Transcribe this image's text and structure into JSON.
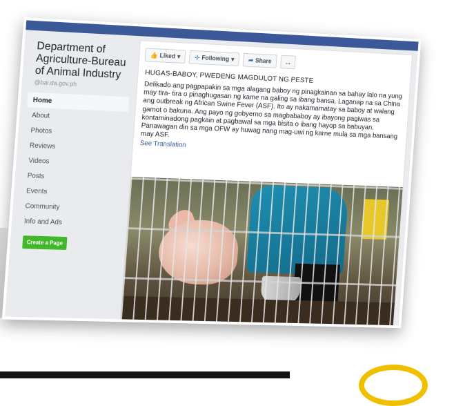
{
  "page": {
    "name_line1": "Department of",
    "name_line2": "Agriculture-Bureau",
    "name_line3": "of Animal Industry",
    "handle": "@bai.da.gov.ph"
  },
  "nav": {
    "items": [
      {
        "label": "Home"
      },
      {
        "label": "About"
      },
      {
        "label": "Photos"
      },
      {
        "label": "Reviews"
      },
      {
        "label": "Videos"
      },
      {
        "label": "Posts"
      },
      {
        "label": "Events"
      },
      {
        "label": "Community"
      },
      {
        "label": "Info and Ads"
      }
    ],
    "create_page_label": "Create a Page"
  },
  "actions": {
    "liked_label": "Liked",
    "following_label": "Following",
    "share_label": "Share",
    "more_label": "..."
  },
  "post": {
    "title": "HUGAS-BABOY, PWEDENG MAGDULOT NG PESTE",
    "body": "Delikado ang pagpapakin sa mga alagang baboy ng pinagkainan sa bahay lalo na yung may tira- tira o pinaghugasan ng kame na galing sa ibang bansa. Laganap na sa China ang outbreak ng African Swine Fever (ASF). Ito ay nakamamatay sa baboy at walang gamot o bakuna. Ang payo ng gobyerno sa magbababoy ay ibayong pagiwas sa kontaminadong pagkain at pagbawal sa mga bisita o ibang hayop sa babuyan. Panawagan din sa mga OFW ay huwag nang mag-uwi ng karne mula sa mga bansang may ASF.",
    "see_translation": "See Translation"
  },
  "icons": {
    "liked": "thumbs-up-icon",
    "following": "rss-icon",
    "share": "share-arrow-icon"
  },
  "colors": {
    "brand": "#3b5998",
    "create_button": "#42b72a",
    "link": "#385898"
  }
}
